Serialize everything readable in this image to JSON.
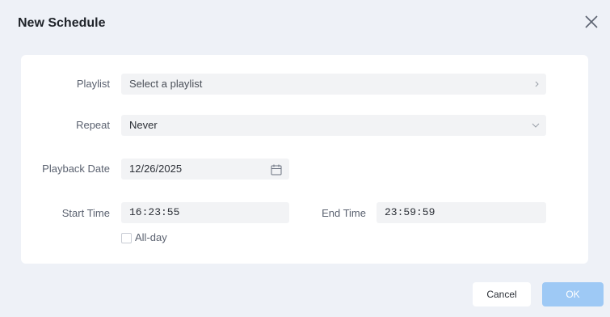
{
  "dialog": {
    "title": "New Schedule"
  },
  "form": {
    "playlist": {
      "label": "Playlist",
      "placeholder": "Select a playlist"
    },
    "repeat": {
      "label": "Repeat",
      "value": "Never"
    },
    "playback_date": {
      "label": "Playback Date",
      "value": "12/26/2025"
    },
    "start_time": {
      "label": "Start Time",
      "value": "16:23:55"
    },
    "end_time": {
      "label": "End Time",
      "value": "23:59:59"
    },
    "all_day": {
      "label": "All-day",
      "checked": false
    }
  },
  "buttons": {
    "cancel": "Cancel",
    "ok": "OK"
  },
  "icons": {
    "close": "close-icon",
    "playlist_arrow": "chevron-right-icon",
    "repeat_arrow": "chevron-down-icon",
    "calendar": "calendar-icon"
  },
  "colors": {
    "background": "#eef1f7",
    "panel": "#ffffff",
    "field": "#f2f3f5",
    "primary_disabled": "#9ec9f5"
  }
}
